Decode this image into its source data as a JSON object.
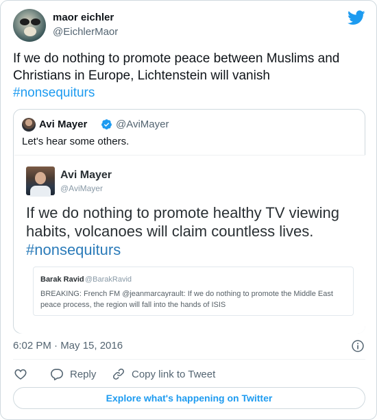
{
  "author": {
    "name": "maor eichler",
    "handle": "@EichlerMaor"
  },
  "tweet": {
    "text": "If we do nothing to promote peace between Muslims and Christians in Europe, Lichtenstein will vanish",
    "hashtag": "#nonsequiturs"
  },
  "quoted_tweet": {
    "name": "Avi Mayer",
    "handle": "@AviMayer",
    "verified": true,
    "text": "Let's hear some others.",
    "image": {
      "name": "Avi Mayer",
      "handle": "@AviMayer",
      "text": "If we do nothing to promote healthy TV viewing habits, volcanoes will claim countless lives.",
      "hashtag": "#nonsequiturs",
      "inner_quote": {
        "name": "Barak Ravid",
        "handle": "@BarakRavid",
        "text": "BREAKING: French FM @jeanmarcayrault: If we do nothing to promote the Middle East peace process, the region will fall into the hands of ISIS"
      }
    }
  },
  "meta": {
    "timestamp": "6:02 PM · May 15, 2016"
  },
  "actions": {
    "reply_label": "Reply",
    "copy_link_label": "Copy link to Tweet"
  },
  "explore_label": "Explore what's happening on Twitter",
  "colors": {
    "accent": "#1d9bf0",
    "text": "#0f1419",
    "secondary": "#536471",
    "border": "#cfd9de"
  },
  "icons": [
    "twitter-bird-icon",
    "verified-badge-icon",
    "info-icon",
    "heart-icon",
    "reply-icon",
    "copy-link-icon"
  ]
}
